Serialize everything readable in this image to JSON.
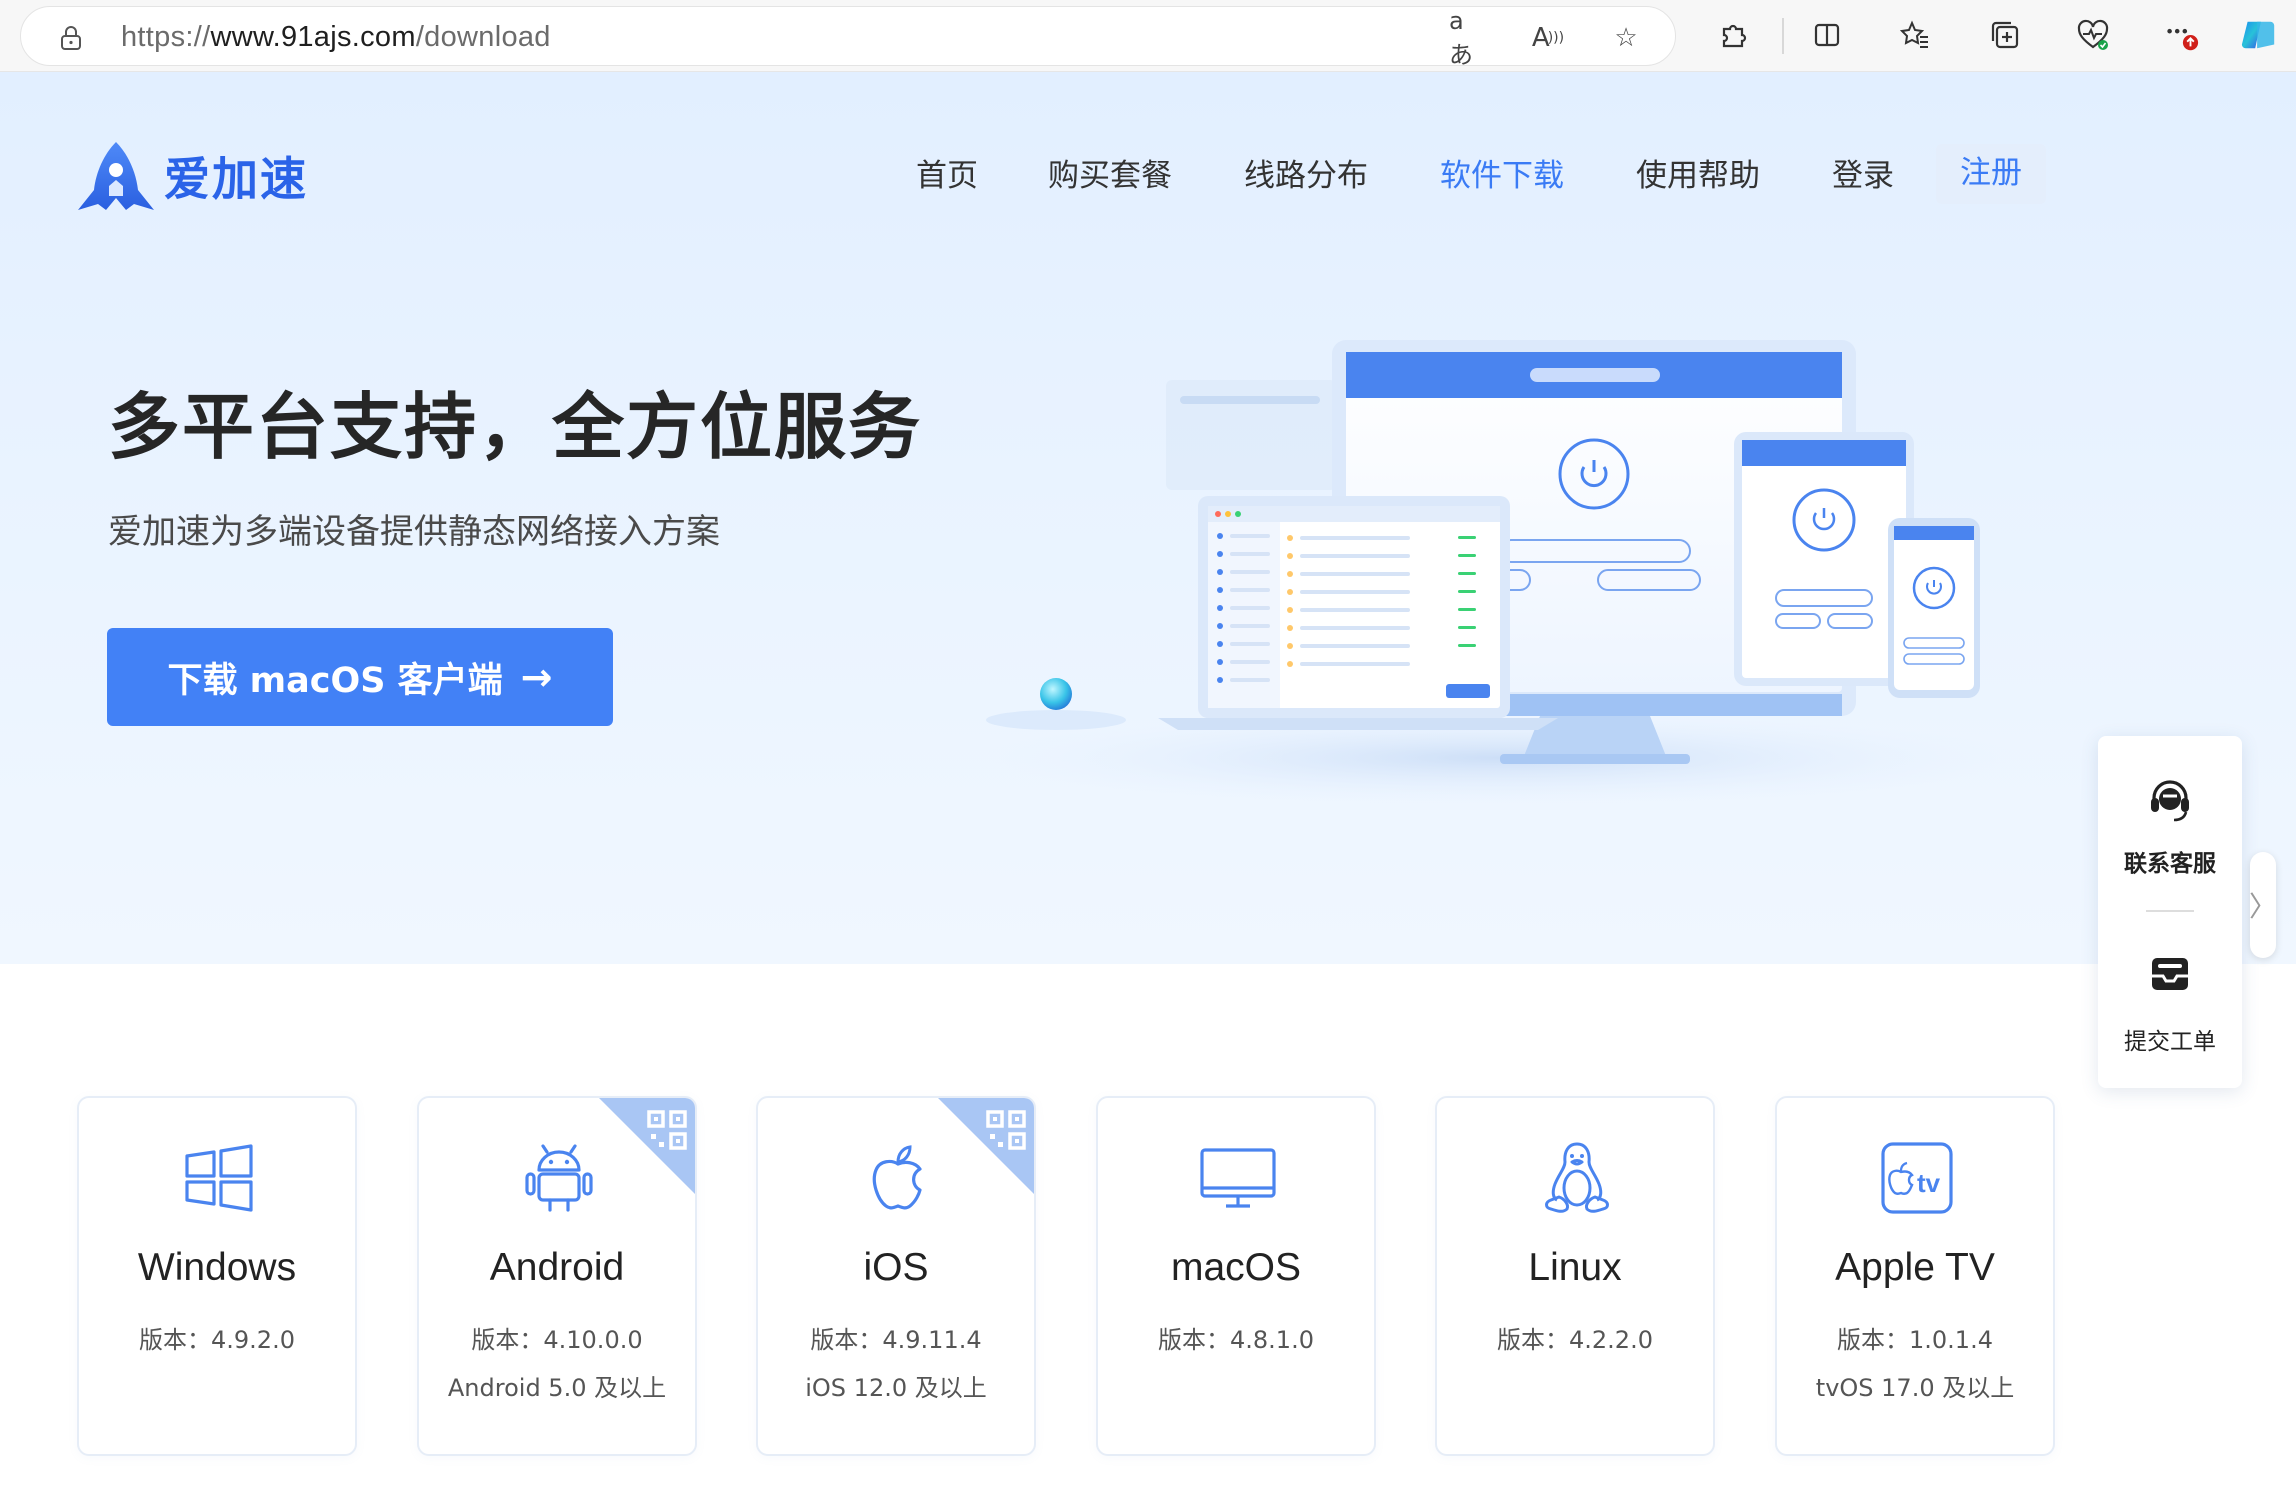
{
  "browser": {
    "url_protocol": "https://",
    "url_host": "www.91ajs.com",
    "url_path": "/download",
    "icons": [
      "lock-icon",
      "translate-icon",
      "read-aloud-icon",
      "favorite-star-icon",
      "extensions-icon",
      "split-screen-icon",
      "favorites-icon",
      "collections-icon",
      "browser-essentials-icon",
      "more-icon",
      "copilot-icon"
    ]
  },
  "brand": {
    "name": "爱加速",
    "color": "#2a63e8"
  },
  "nav": {
    "items": [
      "首页",
      "购买套餐",
      "线路分布",
      "软件下载",
      "使用帮助",
      "登录",
      "注册"
    ],
    "active": "软件下载"
  },
  "hero": {
    "title": "多平台支持，全方位服务",
    "subtitle": "爱加速为多端设备提供静态网络接入方案",
    "button_label": "下载 macOS 客户端"
  },
  "side": {
    "contact_label": "联系客服",
    "ticket_label": "提交工单"
  },
  "platforms": [
    {
      "name": "Windows",
      "version": "版本：4.9.2.0",
      "requirement": "",
      "icon": "windows-icon",
      "qr": false
    },
    {
      "name": "Android",
      "version": "版本：4.10.0.0",
      "requirement": "Android 5.0 及以上",
      "icon": "android-icon",
      "qr": true
    },
    {
      "name": "iOS",
      "version": "版本：4.9.11.4",
      "requirement": "iOS 12.0 及以上",
      "icon": "apple-icon",
      "qr": true
    },
    {
      "name": "macOS",
      "version": "版本：4.8.1.0",
      "requirement": "",
      "icon": "monitor-icon",
      "qr": false
    },
    {
      "name": "Linux",
      "version": "版本：4.2.2.0",
      "requirement": "",
      "icon": "linux-tux-icon",
      "qr": false
    },
    {
      "name": "Apple TV",
      "version": "版本：1.0.1.4",
      "requirement": "tvOS 17.0 及以上",
      "icon": "apple-tv-icon",
      "qr": false
    }
  ],
  "colors": {
    "primary": "#4281f6",
    "hero_bg": "#e6f1ff",
    "text": "#262626"
  }
}
